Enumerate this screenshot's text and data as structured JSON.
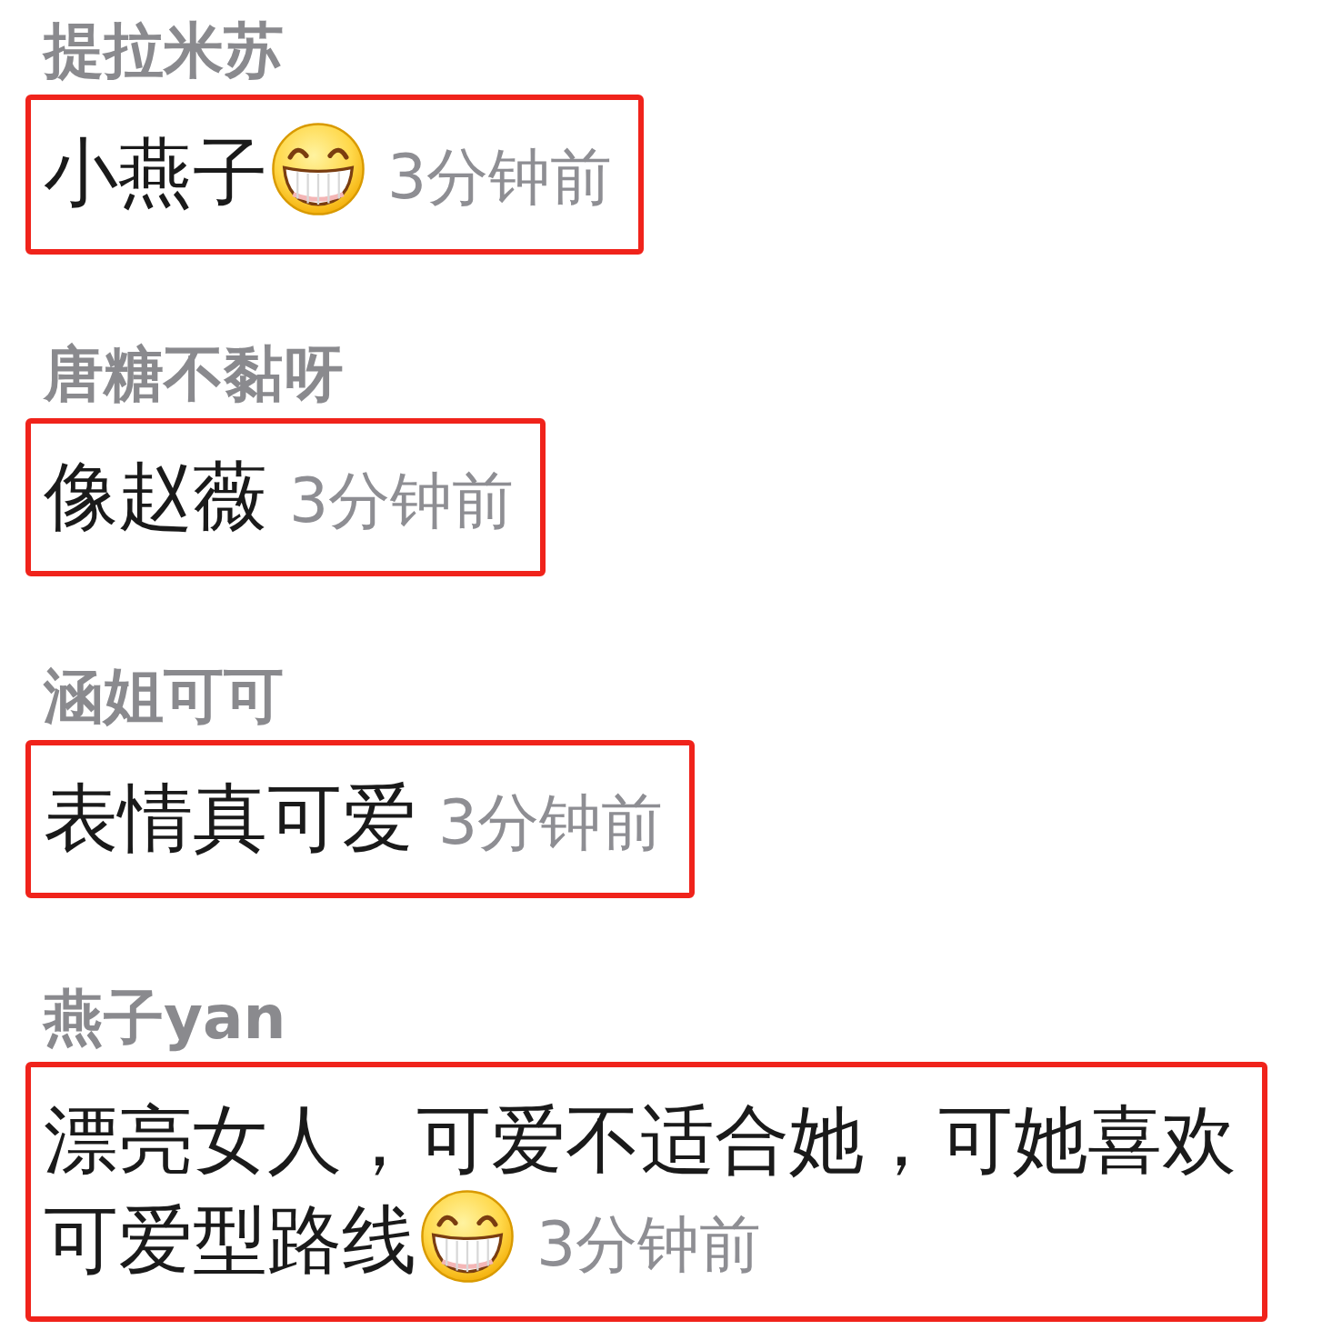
{
  "comments": [
    {
      "username": "提拉米苏",
      "lines": [
        "小燕子"
      ],
      "emoji": true,
      "time": "3分钟前",
      "highlighted": true
    },
    {
      "username": "唐糖不黏呀",
      "lines": [
        "像赵薇"
      ],
      "emoji": false,
      "time": "3分钟前",
      "highlighted": true
    },
    {
      "username": "涵姐可可",
      "lines": [
        "表情真可爱"
      ],
      "emoji": false,
      "time": "3分钟前",
      "highlighted": true
    },
    {
      "username": "燕子yan",
      "lines": [
        "漂亮女人，可爱不适合她，可她喜欢",
        "可爱型路线"
      ],
      "emoji": true,
      "time": "3分钟前",
      "highlighted": true
    }
  ]
}
